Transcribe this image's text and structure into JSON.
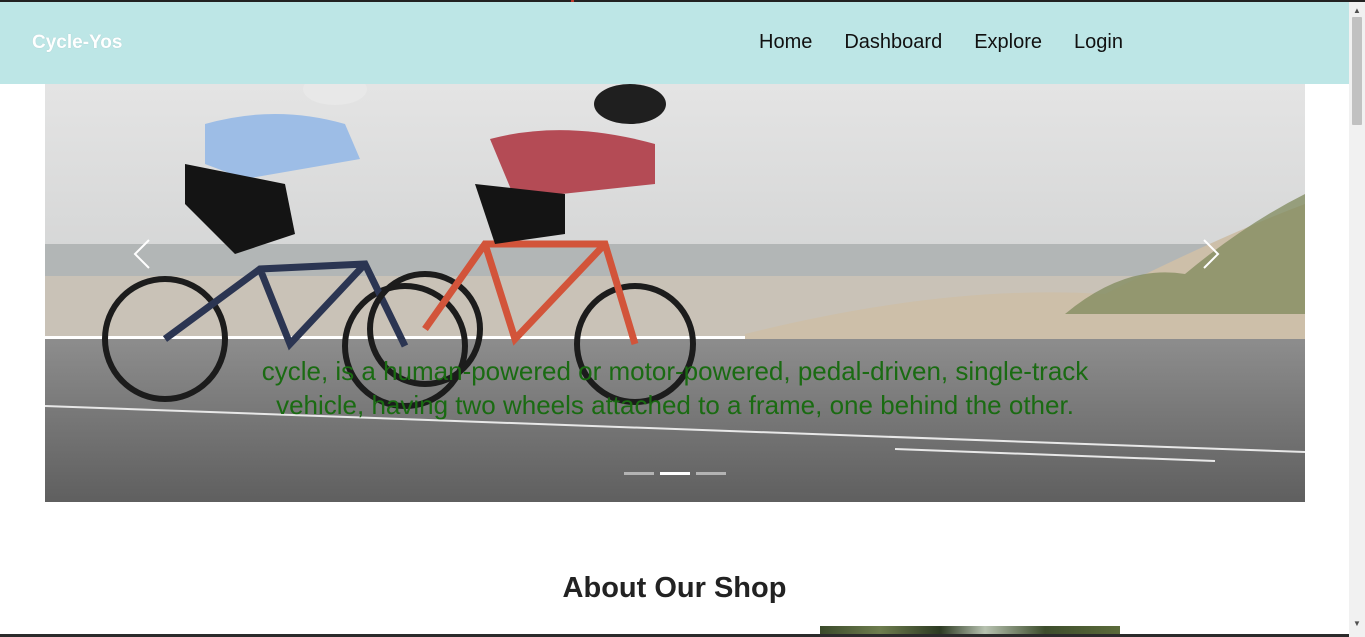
{
  "brand": "Cycle-Yos",
  "nav": {
    "links": [
      "Home",
      "Dashboard",
      "Explore",
      "Login"
    ]
  },
  "carousel": {
    "caption": "cycle, is a human-powered or motor-powered, pedal-driven, single-track vehicle, having two wheels attached to a frame, one behind the other.",
    "slide_count": 3,
    "active_slide": 2,
    "caption_color": "#1a6b12"
  },
  "about": {
    "title": "About Our Shop"
  },
  "colors": {
    "navbar_bg": "#bde6e6",
    "brand_text": "#ffffff"
  },
  "icons": {
    "prev": "chevron-left-icon",
    "next": "chevron-right-icon"
  }
}
